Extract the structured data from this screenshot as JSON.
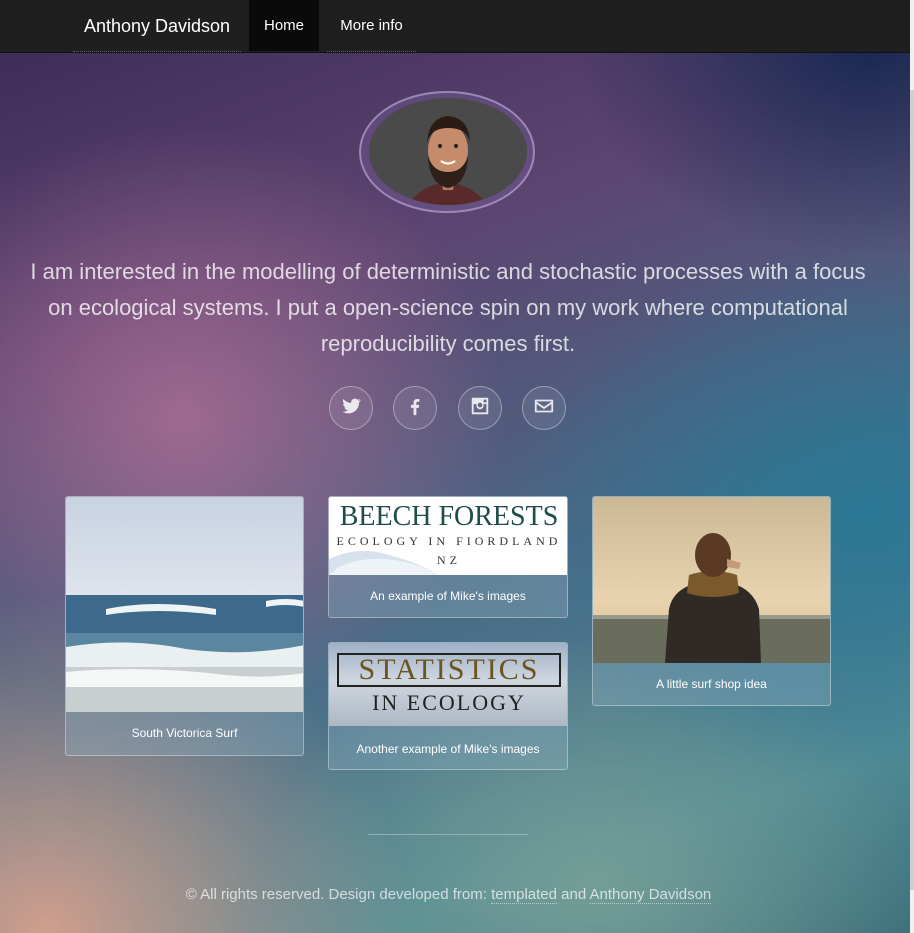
{
  "nav": {
    "brand": "Anthony Davidson",
    "items": [
      {
        "label": "Home"
      },
      {
        "label": "More info"
      }
    ]
  },
  "hero": {
    "bio": "I am interested in the modelling of deterministic and stochastic processes with a focus on ecological systems. I put a open-science spin on my work where computational reproducibility comes first."
  },
  "social": [
    {
      "icon": "twitter-icon"
    },
    {
      "icon": "facebook-icon"
    },
    {
      "icon": "instagram-icon"
    },
    {
      "icon": "email-icon"
    }
  ],
  "cards": [
    {
      "caption": "South Victorica Surf"
    },
    {
      "caption": "An example of Mike's images",
      "banner_title": "BEECH FORESTS",
      "banner_sub": "ECOLOGY IN FIORDLAND",
      "banner_sub2": "NZ"
    },
    {
      "caption": "Another example of Mike's images",
      "banner_title": "STATISTICS",
      "banner_sub": "IN ECOLOGY"
    },
    {
      "caption": "A little surf shop idea"
    }
  ],
  "footer": {
    "text": "© All rights reserved. Design developed from:",
    "link1": "templated",
    "and": "and",
    "link2": "Anthony Davidson"
  }
}
